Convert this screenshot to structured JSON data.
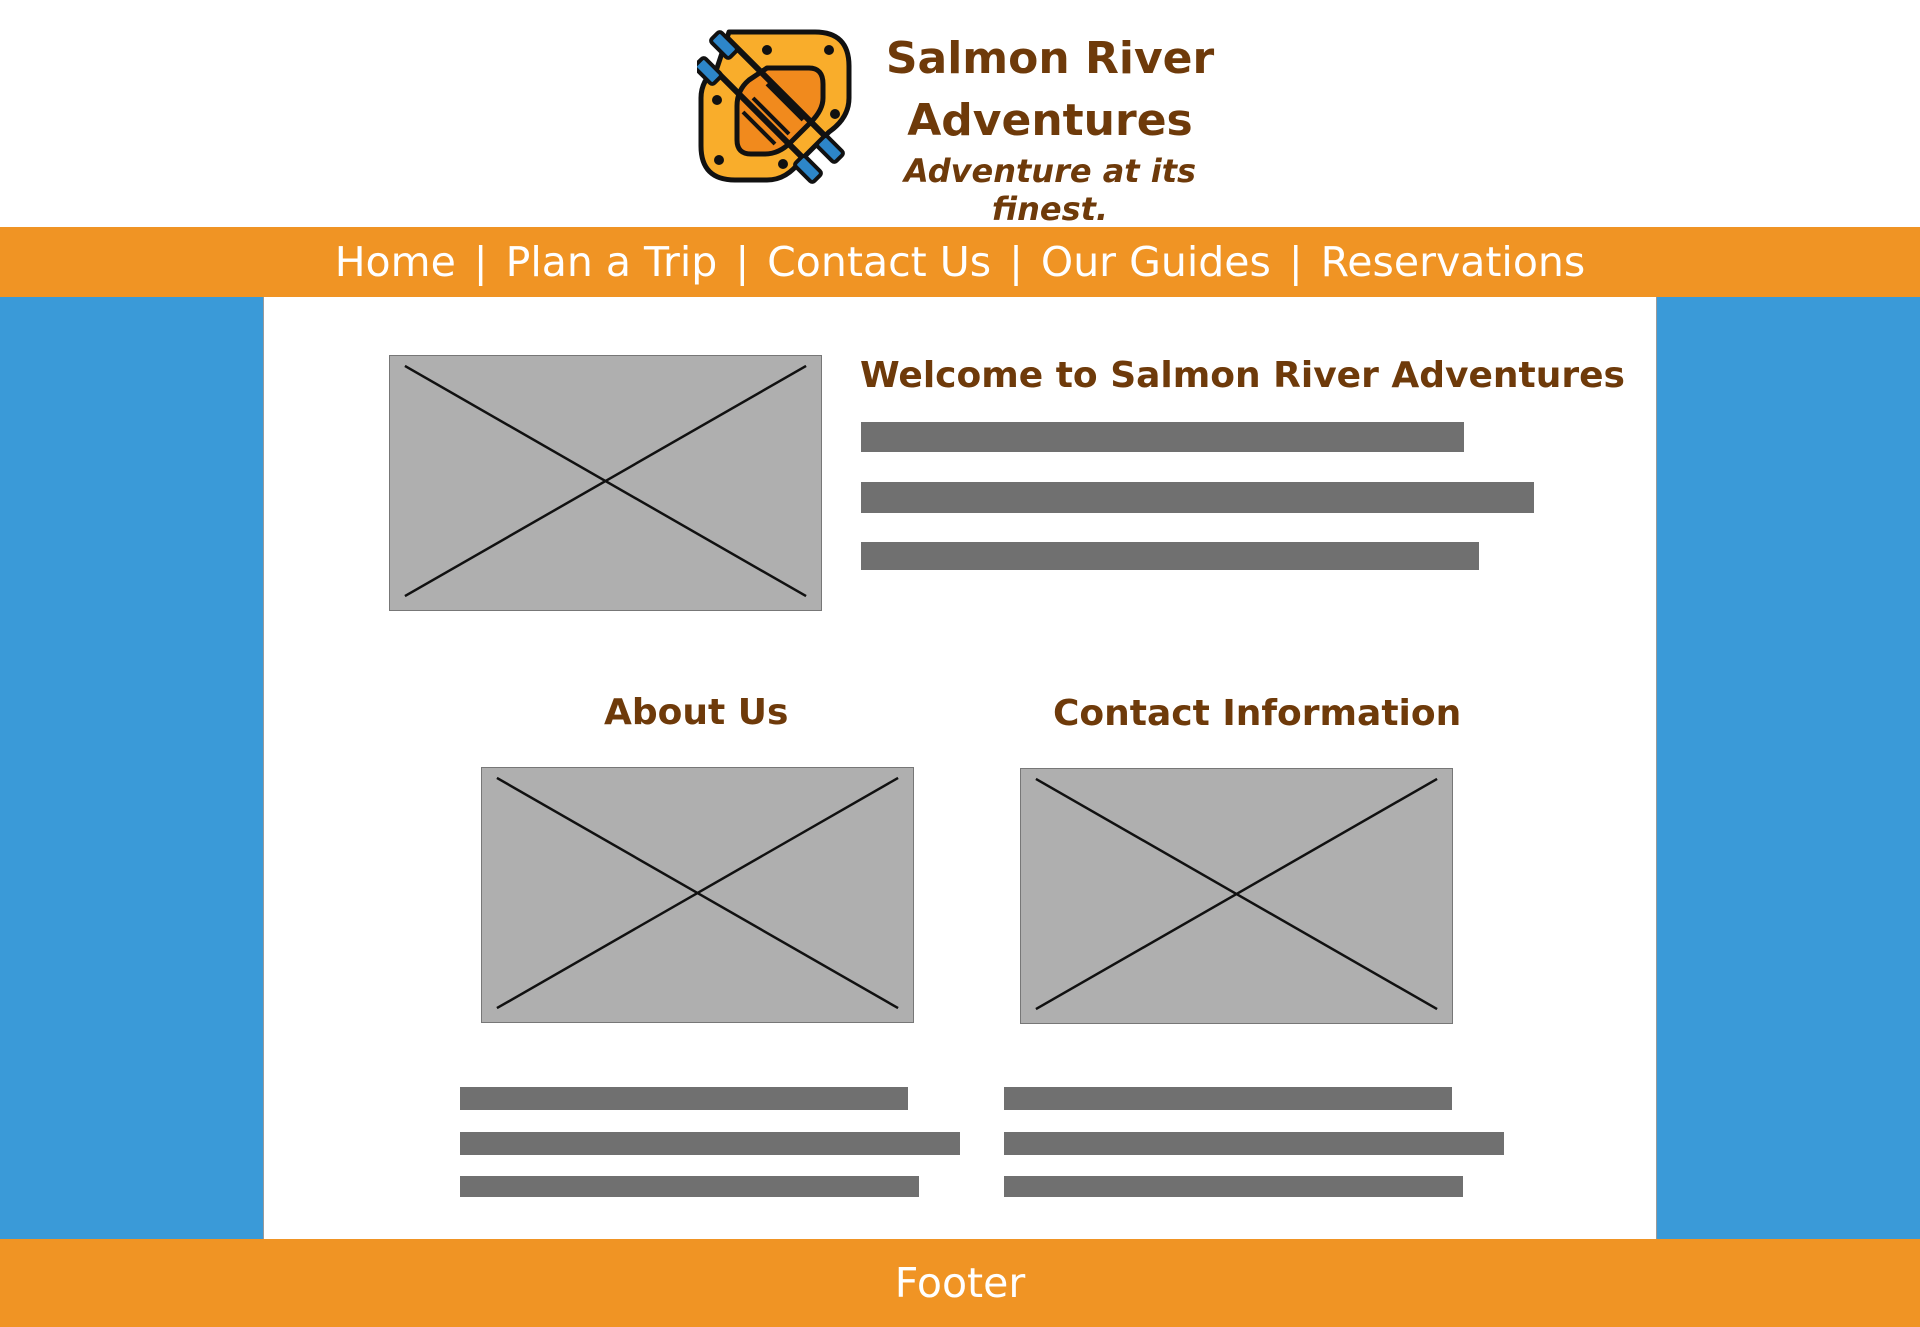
{
  "brand": {
    "title_line1": "Salmon River",
    "title_line2": "Adventures",
    "tagline": "Adventure at its finest."
  },
  "nav": {
    "items": [
      "Home",
      "Plan a Trip",
      "Contact Us",
      "Our Guides",
      "Reservations"
    ],
    "separator": "|"
  },
  "main": {
    "welcome_heading": "Welcome to Salmon River Adventures",
    "about_heading": "About Us",
    "contact_heading": "Contact Information"
  },
  "footer": {
    "label": "Footer"
  },
  "colors": {
    "brand_brown": "#6e3a0a",
    "nav_orange": "#f09424",
    "side_blue": "#3a9ad8",
    "placeholder_gray": "#afafaf",
    "text_bar_gray": "#707070"
  }
}
